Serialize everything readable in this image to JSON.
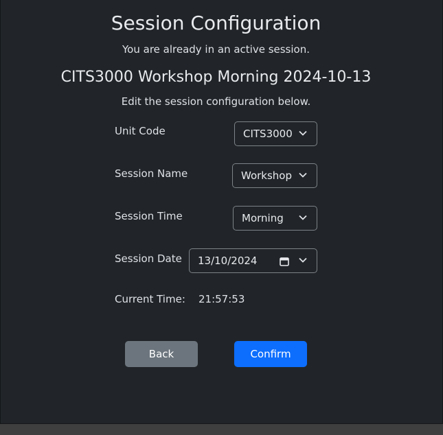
{
  "title": "Session Configuration",
  "active_notice": "You are already in an active session.",
  "session_heading": "CITS3000 Workshop Morning 2024-10-13",
  "edit_notice": "Edit the session configuration below.",
  "fields": {
    "unit_code": {
      "label": "Unit Code",
      "value": "CITS3000"
    },
    "session_name": {
      "label": "Session Name",
      "value": "Workshop"
    },
    "session_time": {
      "label": "Session Time",
      "value": "Morning"
    },
    "session_date": {
      "label": "Session Date",
      "value": "13/10/2024"
    }
  },
  "current_time": {
    "label": "Current Time:",
    "value": "21:57:53"
  },
  "buttons": {
    "back": "Back",
    "confirm": "Confirm"
  },
  "colors": {
    "back": "#6c757d",
    "confirm": "#0d6efd",
    "panel": "#212529"
  },
  "icons": {
    "dropdown": "chevron-down-icon",
    "calendar": "calendar-icon"
  }
}
